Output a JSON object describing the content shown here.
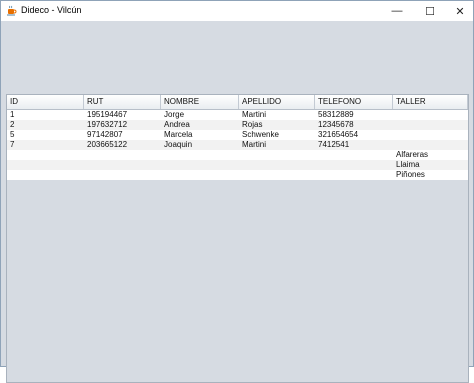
{
  "window": {
    "title": "Dideco - Vilcún",
    "controls": {
      "minimize": "—",
      "maximize": "☐",
      "close": "✕"
    },
    "app_icon": "java-cup-icon"
  },
  "table": {
    "columns": [
      "ID",
      "RUT",
      "NOMBRE",
      "APELLIDO",
      "TELEFONO",
      "TALLER"
    ],
    "rows": [
      [
        "1",
        "195194467",
        "Jorge",
        "Martini",
        "58312889",
        ""
      ],
      [
        "2",
        "197632712",
        "Andrea",
        "Rojas",
        "12345678",
        ""
      ],
      [
        "5",
        "97142807",
        "Marcela",
        "Schwenke",
        "321654654",
        ""
      ],
      [
        "7",
        "203665122",
        "Joaquin",
        "Martini",
        "7412541",
        ""
      ],
      [
        "",
        "",
        "",
        "",
        "",
        "Alfareras"
      ],
      [
        "",
        "",
        "",
        "",
        "",
        "Llaima"
      ],
      [
        "",
        "",
        "",
        "",
        "",
        "Piñones"
      ]
    ]
  }
}
